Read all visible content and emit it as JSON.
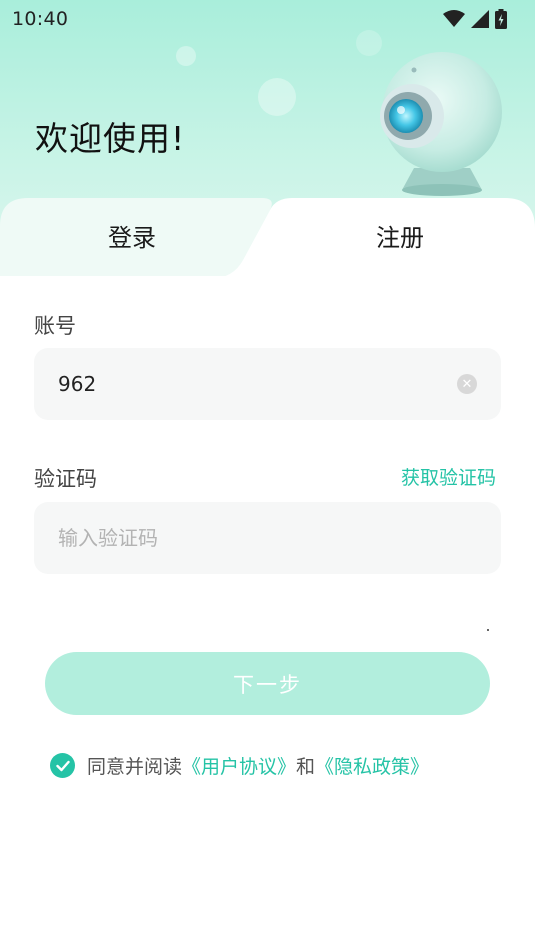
{
  "status_bar": {
    "time": "10:40",
    "icons": [
      "wifi-icon",
      "signal-icon",
      "battery-icon"
    ]
  },
  "hero": {
    "welcome_text": "欢迎使用!"
  },
  "tabs": [
    {
      "label": "登录",
      "active": false
    },
    {
      "label": "注册",
      "active": true
    }
  ],
  "form": {
    "account": {
      "label": "账号",
      "value": "962",
      "placeholder": ""
    },
    "code": {
      "label": "验证码",
      "value": "",
      "placeholder": "输入验证码",
      "get_code_label": "获取验证码"
    },
    "next_label": "下一步"
  },
  "agreement": {
    "checked": true,
    "prefix": "同意并阅读",
    "user_agreement": "《用户协议》",
    "and": "和",
    "privacy_policy": "《隐私政策》"
  },
  "colors": {
    "accent": "#25c3a6",
    "button_disabled": "#b2eedd",
    "hero_top": "#a9eedb",
    "input_bg": "#f6f7f7"
  }
}
